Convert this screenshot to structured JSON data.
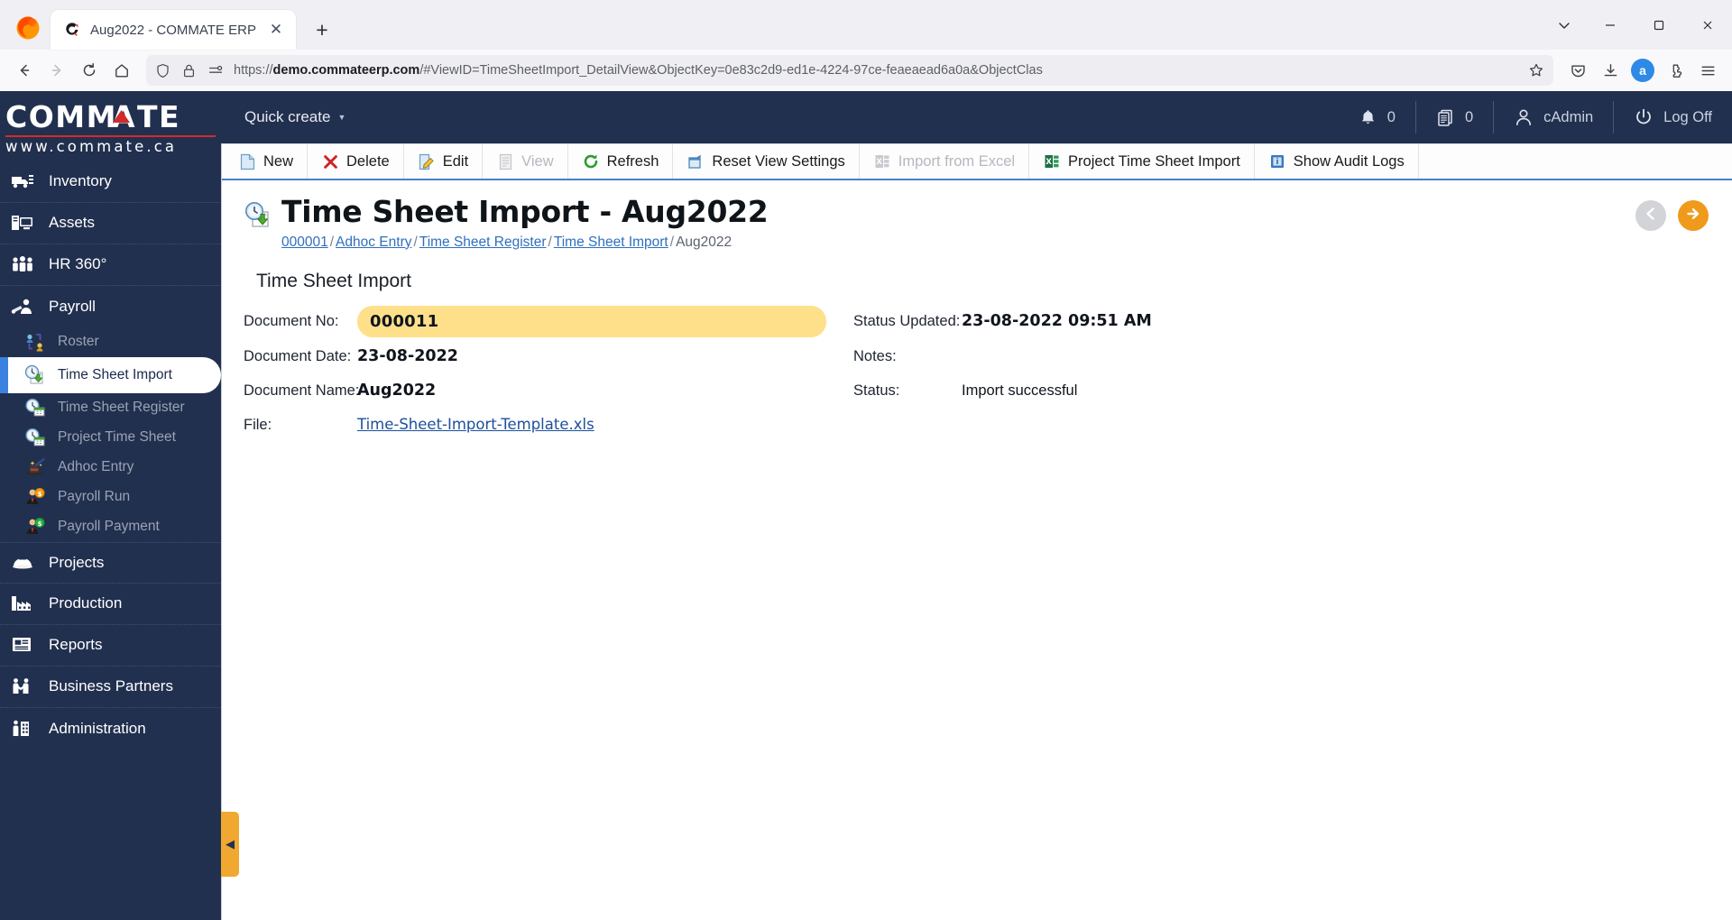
{
  "browser": {
    "tab": {
      "title": "Aug2022 - COMMATE ERP",
      "favicon_icon": "commate-c-favicon",
      "close_icon": "close-icon"
    },
    "new_tab_icon": "plus-icon",
    "window_controls": {
      "list_all_tabs_icon": "chevron-down-icon",
      "minimize_icon": "minimize-icon",
      "maximize_icon": "maximize-icon",
      "close_icon": "window-close-icon"
    },
    "nav": {
      "back_icon": "back-arrow-icon",
      "forward_icon": "forward-arrow-icon",
      "reload_icon": "reload-icon",
      "home_icon": "home-icon",
      "shield_icon": "shield-icon",
      "lock_icon": "padlock-icon",
      "permissions_icon": "site-permissions-icon",
      "bookmark_icon": "star-icon",
      "url_scheme": "https://",
      "url_domain": "demo.commateerp.com",
      "url_path": "/#ViewID=TimeSheetImport_DetailView&ObjectKey=0e83c2d9-ed1e-4224-97ce-feaeaead6a0a&ObjectClas",
      "pocket_icon": "pocket-icon",
      "downloads_icon": "downloads-icon",
      "account_initial": "a",
      "extensions_icon": "extensions-icon",
      "menu_icon": "hamburger-menu-icon"
    }
  },
  "sidebar": {
    "logo_text": "COMMATE",
    "logo_url": "www.commate.ca",
    "items": [
      {
        "label": "Inventory",
        "icon": "truck-icon"
      },
      {
        "label": "Assets",
        "icon": "computer-icon"
      },
      {
        "label": "HR 360°",
        "icon": "people-group-icon"
      },
      {
        "label": "Payroll",
        "icon": "payroll-person-icon"
      }
    ],
    "payroll_children": [
      {
        "label": "Roster",
        "icon": "roster-icon",
        "active": false
      },
      {
        "label": "Time Sheet Import",
        "icon": "clock-import-icon",
        "active": true
      },
      {
        "label": "Time Sheet Register",
        "icon": "clock-calendar-icon",
        "active": false
      },
      {
        "label": "Project Time Sheet",
        "icon": "clock-calendar-icon",
        "active": false
      },
      {
        "label": "Adhoc Entry",
        "icon": "magic-hat-icon",
        "active": false
      },
      {
        "label": "Payroll Run",
        "icon": "person-coin-icon",
        "active": false
      },
      {
        "label": "Payroll Payment",
        "icon": "person-money-icon",
        "active": false
      }
    ],
    "items_bottom": [
      {
        "label": "Projects",
        "icon": "hardhat-icon"
      },
      {
        "label": "Production",
        "icon": "factory-icon"
      },
      {
        "label": "Reports",
        "icon": "report-icon"
      },
      {
        "label": "Business Partners",
        "icon": "handshake-icon"
      },
      {
        "label": "Administration",
        "icon": "admin-building-icon"
      }
    ],
    "collapse_icon": "collapse-left-arrow-icon"
  },
  "topbar": {
    "quick_create": "Quick create",
    "quick_create_caret_icon": "caret-down-icon",
    "notifications": {
      "icon": "bell-icon",
      "count": "0"
    },
    "documents": {
      "icon": "documents-icon",
      "count": "0"
    },
    "user": {
      "icon": "user-icon",
      "name": "cAdmin"
    },
    "logoff": {
      "icon": "power-icon",
      "label": "Log Off"
    }
  },
  "toolbar": {
    "buttons": [
      {
        "label": "New",
        "icon": "new-document-icon",
        "disabled": false
      },
      {
        "label": "Delete",
        "icon": "delete-x-icon",
        "disabled": false
      },
      {
        "label": "Edit",
        "icon": "edit-pencil-icon",
        "disabled": false
      },
      {
        "label": "View",
        "icon": "view-document-icon",
        "disabled": true
      },
      {
        "label": "Refresh",
        "icon": "refresh-icon",
        "disabled": false
      },
      {
        "label": "Reset View Settings",
        "icon": "reset-view-icon",
        "disabled": false
      },
      {
        "label": "Import from Excel",
        "icon": "excel-icon",
        "disabled": true
      },
      {
        "label": "Project Time Sheet Import",
        "icon": "excel-icon",
        "disabled": false
      },
      {
        "label": "Show Audit Logs",
        "icon": "audit-log-icon",
        "disabled": false
      }
    ]
  },
  "page": {
    "icon": "clock-import-icon",
    "title": "Time Sheet Import - Aug2022",
    "breadcrumb": [
      {
        "label": "000001",
        "link": true
      },
      {
        "label": "Adhoc Entry",
        "link": true
      },
      {
        "label": "Time Sheet Register",
        "link": true
      },
      {
        "label": "Time Sheet Import",
        "link": true
      },
      {
        "label": "Aug2022",
        "link": false
      }
    ],
    "breadcrumb_separator": "/",
    "prev_icon": "arrow-left-icon",
    "next_icon": "arrow-right-icon",
    "section_title": "Time Sheet Import",
    "fields_left": [
      {
        "label": "Document No:",
        "value": "000011",
        "style": "highlight"
      },
      {
        "label": "Document Date:",
        "value": "23-08-2022",
        "style": "bold"
      },
      {
        "label": "Document Name:",
        "value": "Aug2022",
        "style": "bold"
      },
      {
        "label": "File:",
        "value": "Time-Sheet-Import-Template.xls",
        "style": "link"
      }
    ],
    "fields_right": [
      {
        "label": "Status Updated:",
        "value": "23-08-2022 09:51 AM",
        "style": "bold"
      },
      {
        "label": "Notes:",
        "value": "",
        "style": "plain"
      },
      {
        "label": "Status:",
        "value": "Import successful",
        "style": "plain"
      }
    ]
  }
}
